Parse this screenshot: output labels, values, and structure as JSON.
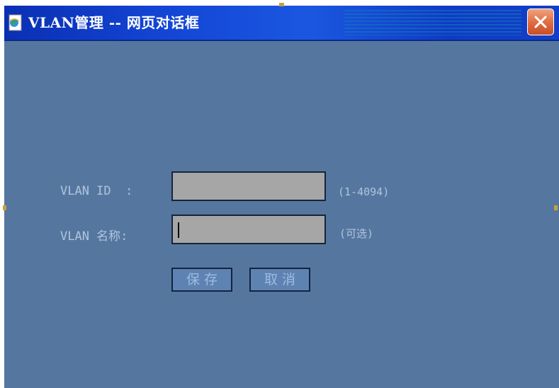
{
  "window": {
    "title": "VLAN管理 -- 网页对话框",
    "icon": "ie-page-icon",
    "close_icon": "close-icon"
  },
  "form": {
    "vlan_id": {
      "label": "VLAN ID  :",
      "value": "",
      "hint": "(1-4094)"
    },
    "vlan_name": {
      "label": "VLAN 名称:",
      "value": "",
      "hint": "(可选)"
    }
  },
  "buttons": {
    "save_label": "保存",
    "cancel_label": "取消"
  },
  "colors": {
    "dialog_background": "#55779f",
    "titlebar": "#1446d6",
    "close_button": "#e06f43",
    "input_background": "#a6a6a6",
    "label_text": "#b0c4de"
  }
}
